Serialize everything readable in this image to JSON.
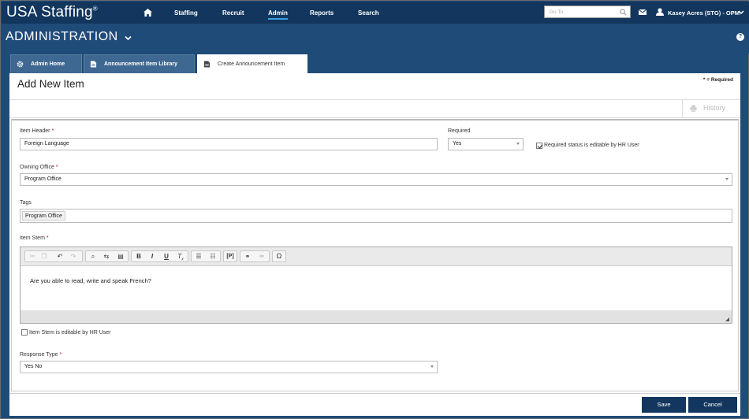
{
  "header": {
    "logo_text": "USA Staffing",
    "logo_mark": "®",
    "nav": [
      {
        "label": "Staffing"
      },
      {
        "label": "Recruit"
      },
      {
        "label": "Admin",
        "active": true
      },
      {
        "label": "Reports"
      },
      {
        "label": "Search"
      }
    ],
    "goto_placeholder": "Go To",
    "user_name": "Kasey Acres (STG) - OPM"
  },
  "section": {
    "title": "ADMINISTRATION",
    "help_symbol": "?"
  },
  "tabs": [
    {
      "label": "Admin Home",
      "icon": "gear-icon"
    },
    {
      "label": "Announcement Item Library",
      "icon": "document-icon"
    },
    {
      "label": "Create Announcement Item",
      "icon": "document-icon",
      "active": true
    }
  ],
  "page": {
    "title": "Add New Item",
    "required_note": "* = Required",
    "history_label": "History"
  },
  "form": {
    "item_header": {
      "label": "Item Header",
      "required_mark": "*",
      "value": "Foreign Language"
    },
    "required": {
      "label": "Required",
      "value": "Yes"
    },
    "required_editable": {
      "label": "Required status is editable by HR User",
      "checked": true
    },
    "owning_office": {
      "label": "Owning Office",
      "required_mark": "*",
      "value": "Program Office"
    },
    "tags": {
      "label": "Tags",
      "chips": [
        "Program Office"
      ]
    },
    "item_stem": {
      "label": "Item Stem",
      "required_mark": "*",
      "content": "Are you able to read, write and speak French?"
    },
    "stem_editable": {
      "label": "Item Stem is editable by HR User",
      "checked": false
    },
    "response_type": {
      "label": "Response Type",
      "required_mark": "*",
      "value": "Yes No"
    }
  },
  "footer": {
    "save_label": "Save",
    "cancel_label": "Cancel"
  },
  "colors": {
    "nav_bg": "#12365e",
    "bar_bg": "#1f4b79",
    "tab_bg": "#3e6891",
    "required_star": "#b5121b"
  }
}
